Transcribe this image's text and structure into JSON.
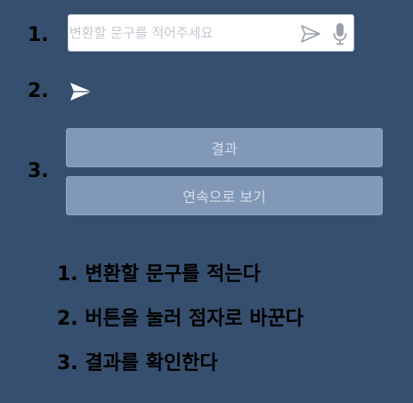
{
  "step_numbers": [
    "1.",
    "2.",
    "3."
  ],
  "search": {
    "placeholder": "변환할 문구를 적어주세요",
    "value": ""
  },
  "icons": {
    "send_inline": "send-icon",
    "mic": "microphone-icon",
    "send_large": "send-icon"
  },
  "buttons": {
    "result": "결과",
    "continuous": "연속으로 보기"
  },
  "instructions": [
    "1. 변환할 문구를 적는다",
    "2. 버튼을 눌러 점자로 바꾼다",
    "3. 결과를 확인한다"
  ],
  "colors": {
    "background": "#374f6e",
    "button_bg": "#8198b7",
    "button_text": "#d4dce8",
    "text": "#000000"
  }
}
